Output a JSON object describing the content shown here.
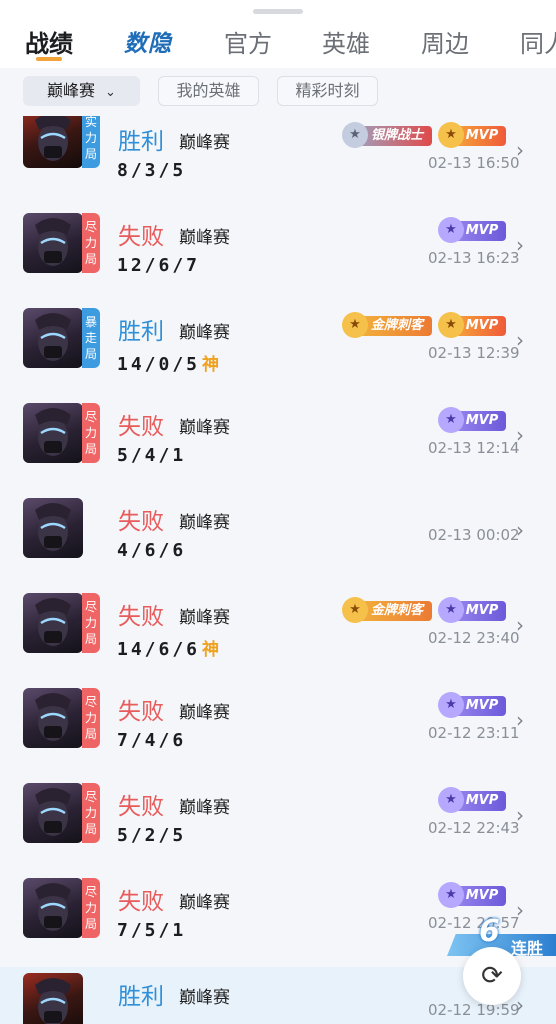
{
  "tabs": [
    {
      "label": "战绩",
      "active": true
    },
    {
      "label": "数隐",
      "active": false
    },
    {
      "label": "官方",
      "active": false
    },
    {
      "label": "英雄",
      "active": false
    },
    {
      "label": "周边",
      "active": false
    },
    {
      "label": "同人",
      "active": false
    }
  ],
  "filters": {
    "mode_select": "巅峰赛",
    "my_heroes": "我的英雄",
    "highlights": "精彩时刻"
  },
  "matches": [
    {
      "result": "胜利",
      "mode": "巅峰赛",
      "kda": "8/3/5",
      "time": "02-13 16:50",
      "badge": [
        "实",
        "力",
        "局"
      ],
      "tags": [
        "银牌战士",
        "MVP"
      ]
    },
    {
      "result": "失败",
      "mode": "巅峰赛",
      "kda": "12/6/7",
      "time": "02-13 16:23",
      "badge": [
        "尽",
        "力",
        "局"
      ],
      "tags": [
        "MVP"
      ]
    },
    {
      "result": "胜利",
      "mode": "巅峰赛",
      "kda": "14/0/5",
      "time": "02-13 12:39",
      "badge": [
        "暴",
        "走",
        "局"
      ],
      "tags": [
        "金牌刺客",
        "MVP"
      ],
      "god": "神"
    },
    {
      "result": "失败",
      "mode": "巅峰赛",
      "kda": "5/4/1",
      "time": "02-13 12:14",
      "badge": [
        "尽",
        "力",
        "局"
      ],
      "tags": [
        "MVP"
      ]
    },
    {
      "result": "失败",
      "mode": "巅峰赛",
      "kda": "4/6/6",
      "time": "02-13 00:02",
      "badge": [],
      "tags": []
    },
    {
      "result": "失败",
      "mode": "巅峰赛",
      "kda": "14/6/6",
      "time": "02-12 23:40",
      "badge": [
        "尽",
        "力",
        "局"
      ],
      "tags": [
        "金牌刺客",
        "MVP"
      ],
      "god": "神"
    },
    {
      "result": "失败",
      "mode": "巅峰赛",
      "kda": "7/4/6",
      "time": "02-12 23:11",
      "badge": [
        "尽",
        "力",
        "局"
      ],
      "tags": [
        "MVP"
      ]
    },
    {
      "result": "失败",
      "mode": "巅峰赛",
      "kda": "5/2/5",
      "time": "02-12 22:43",
      "badge": [
        "尽",
        "力",
        "局"
      ],
      "tags": [
        "MVP"
      ]
    },
    {
      "result": "失败",
      "mode": "巅峰赛",
      "kda": "7/5/1",
      "time": "02-12 20:57",
      "badge": [
        "尽",
        "力",
        "局"
      ],
      "tags": [
        "MVP"
      ]
    },
    {
      "result": "胜利",
      "mode": "巅峰赛",
      "kda": "",
      "time": "02-12 19:59",
      "badge": [],
      "tags": []
    }
  ],
  "streak": {
    "count": "6",
    "label": "连胜"
  },
  "icons": {
    "chevron": "chevron-down-icon",
    "arrow": "chevron-right-icon",
    "refresh": "refresh-icon"
  },
  "colors": {
    "win": "#2f8fd8",
    "lose": "#e85b5b",
    "accent": "#f2a33a"
  }
}
